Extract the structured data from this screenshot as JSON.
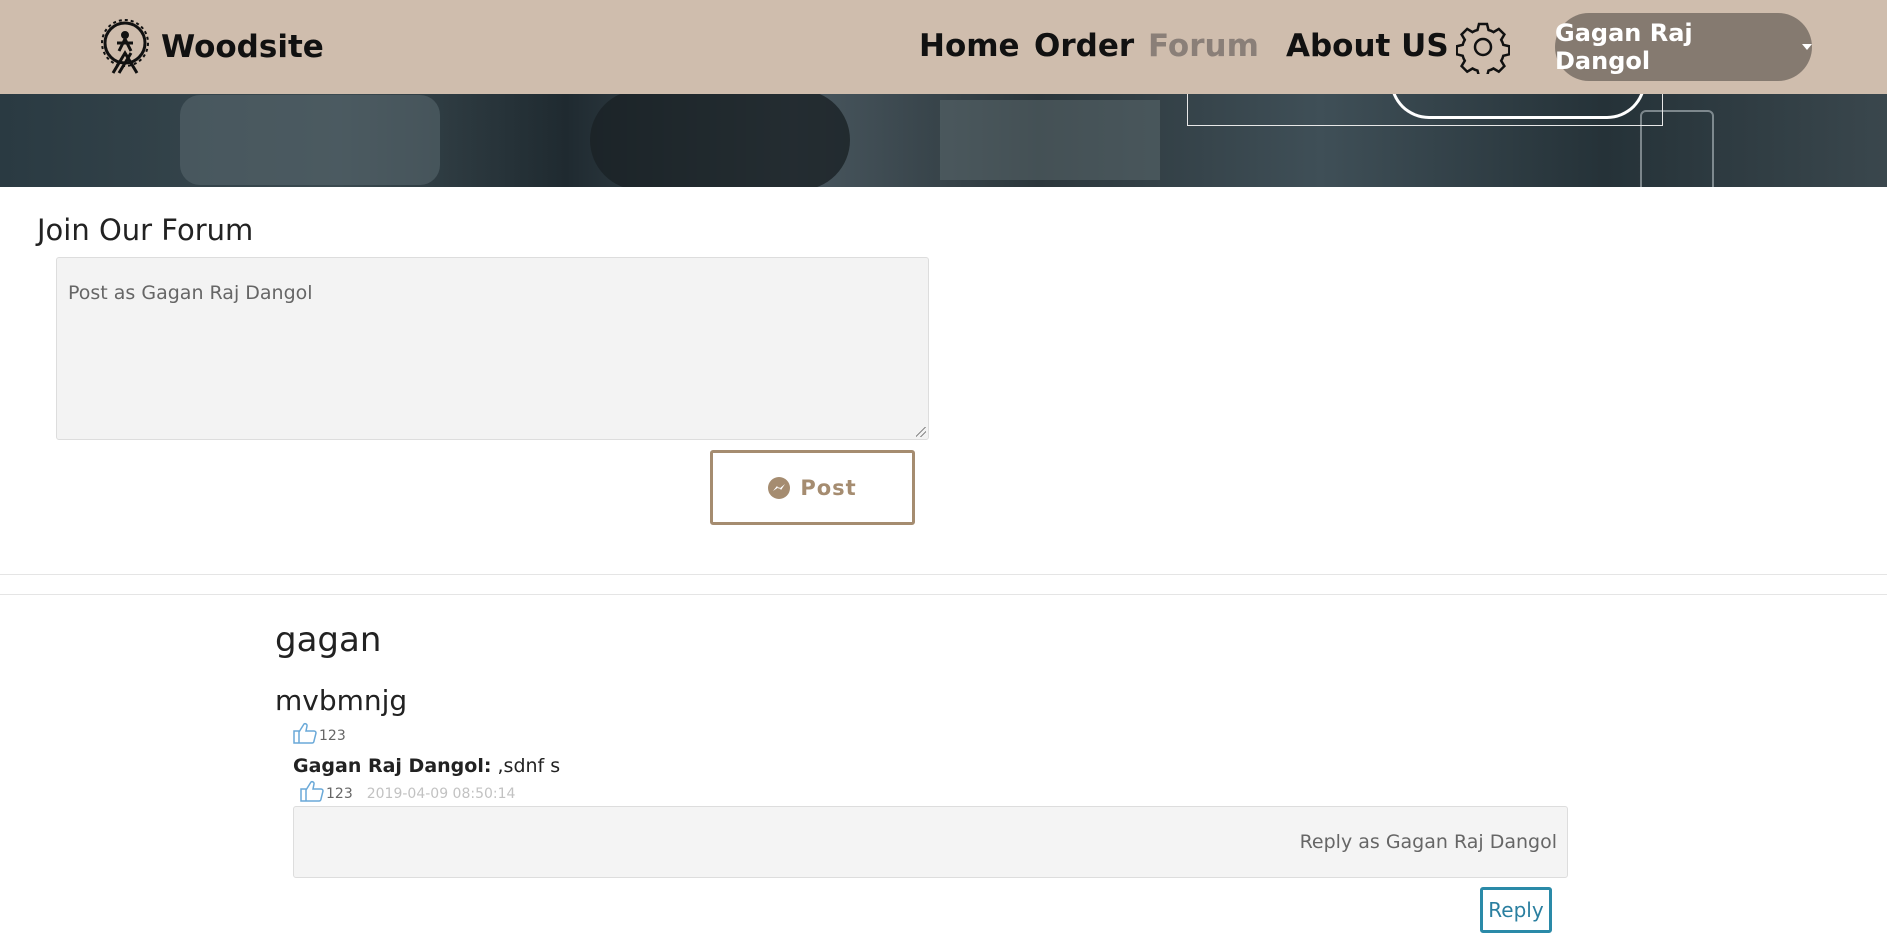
{
  "brand": {
    "name": "Woodsite"
  },
  "nav": {
    "items": [
      {
        "label": "Home",
        "active": false
      },
      {
        "label": "Order",
        "active": false
      },
      {
        "label": "Forum",
        "active": true
      },
      {
        "label": "About US",
        "active": false
      }
    ],
    "settings_icon": "gear-icon",
    "user_menu_label": "Gagan Raj Dangol"
  },
  "forum": {
    "title": "Join Our Forum",
    "post_placeholder": "Post as Gagan Raj Dangol",
    "post_button_label": "Post",
    "post_button_icon": "messenger-icon"
  },
  "thread": {
    "author": "gagan",
    "body": "mvbmnjg",
    "likes": "123",
    "replies": [
      {
        "author": "Gagan Raj Dangol:",
        "text": ",sdnf s",
        "likes": "123",
        "timestamp": "2019-04-09 08:50:14"
      }
    ],
    "reply_placeholder": "Reply as Gagan Raj Dangol",
    "reply_button_label": "Reply"
  },
  "colors": {
    "navbar_bg": "#cfbdad",
    "user_button_bg": "#857a70",
    "accent_brown": "#a58c70",
    "reply_blue": "#2a8aa8",
    "like_icon_blue": "#6aa9d8"
  }
}
